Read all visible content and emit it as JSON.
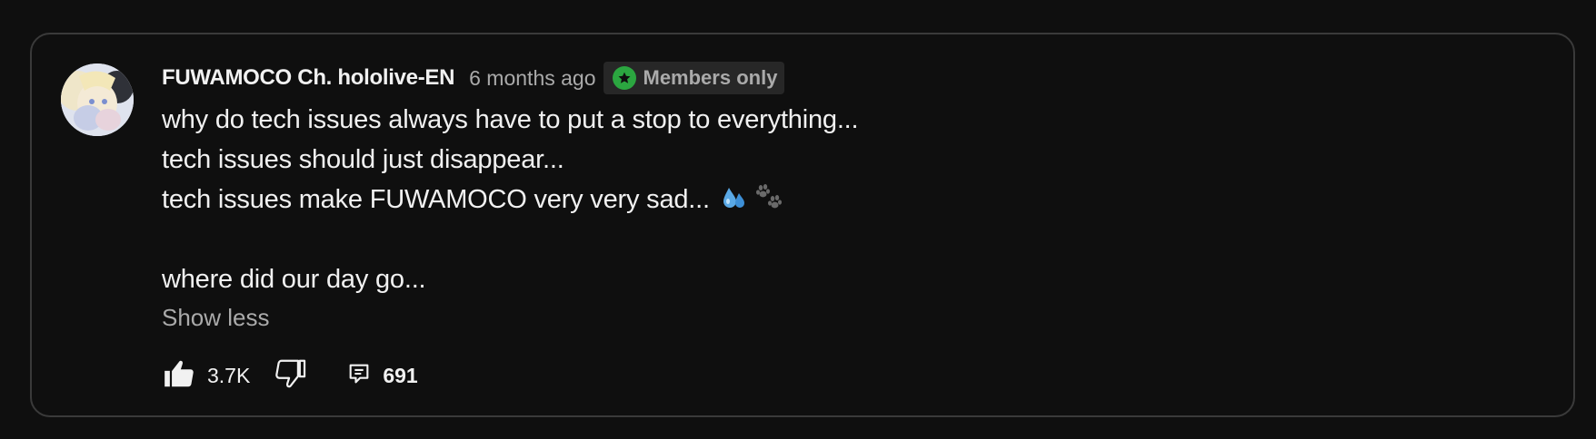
{
  "comment": {
    "author": "FUWAMOCO Ch. hololive-EN",
    "time": "6 months ago",
    "badge": {
      "label": "Members only",
      "icon": "star-icon",
      "color": "#2ba640"
    },
    "lines": [
      "why do tech issues always have to put a stop to everything...",
      "tech issues should just disappear...",
      "tech issues make FUWAMOCO very very sad...",
      "",
      "where did our day go..."
    ],
    "emoji": [
      "sweat-droplets-emoji",
      "paw-prints-emoji"
    ],
    "show_less": "Show less",
    "likes": "3.7K",
    "replies": "691"
  },
  "colors": {
    "background": "#0f0f0f",
    "border": "#3a3a3a",
    "secondary_text": "#aaaaaa",
    "primary_text": "#f1f1f1"
  }
}
